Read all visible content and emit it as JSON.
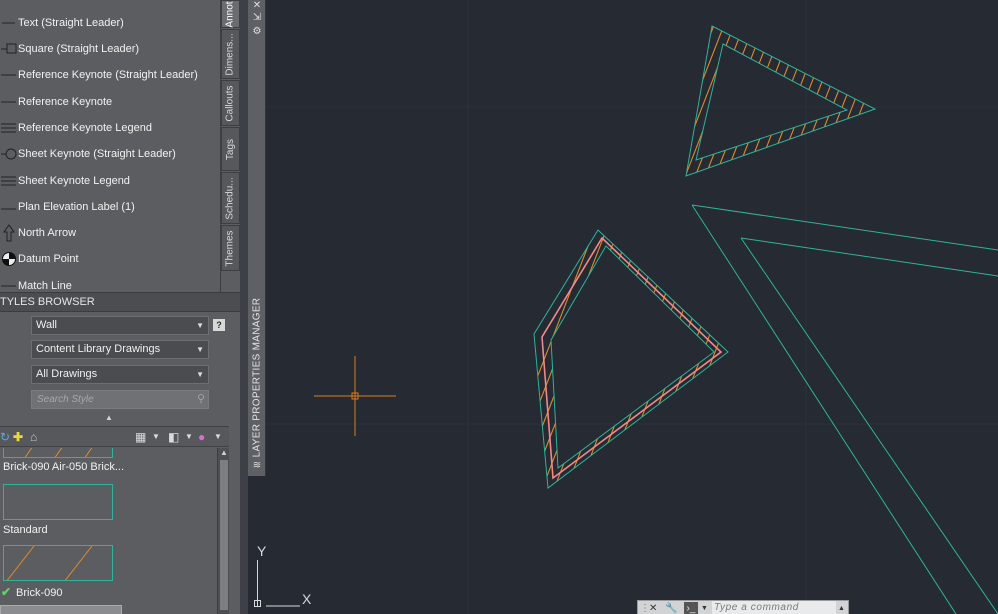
{
  "tool_palette": {
    "items": [
      {
        "label": "Text (Straight Leader)",
        "icon": "text-leader-icon"
      },
      {
        "label": "Square (Straight Leader)",
        "icon": "square-leader-icon"
      },
      {
        "label": "Reference Keynote (Straight Leader)",
        "icon": "keynote-leader-icon"
      },
      {
        "label": "Reference Keynote",
        "icon": "keynote-icon"
      },
      {
        "label": "Reference Keynote Legend",
        "icon": "keynote-legend-icon"
      },
      {
        "label": "Sheet Keynote (Straight Leader)",
        "icon": "sheet-keynote-leader-icon"
      },
      {
        "label": "Sheet Keynote Legend",
        "icon": "sheet-keynote-legend-icon"
      },
      {
        "label": "Plan Elevation Label (1)",
        "icon": "elevation-label-icon"
      },
      {
        "label": "North Arrow",
        "icon": "north-arrow-icon"
      },
      {
        "label": "Datum Point",
        "icon": "datum-point-icon"
      },
      {
        "label": "Match Line",
        "icon": "match-line-icon"
      }
    ],
    "tabs": [
      "Annot",
      "Dimens...",
      "Callouts",
      "Tags",
      "Schedu...",
      "Themes"
    ]
  },
  "layer_manager": {
    "label": "LAYER PROPERTIES MANAGER"
  },
  "styles_browser": {
    "title": "TYLES BROWSER",
    "object_type": "Wall",
    "source": "Content Library Drawings",
    "filter": "All Drawings",
    "search_placeholder": "Search Style",
    "styles": [
      {
        "name": "Brick-090 Air-050 Brick...",
        "current": false
      },
      {
        "name": "Standard",
        "current": false
      },
      {
        "name": "Brick-090",
        "current": true
      }
    ]
  },
  "command_line": {
    "placeholder": "Type a command"
  },
  "ucs": {
    "x": "X",
    "y": "Y"
  },
  "colors": {
    "canvas": "#252a33",
    "wall_outline": "#2fb39a",
    "hatch": "#e08a2c",
    "selected": "#f08a8a",
    "crosshair": "#e07a1c"
  }
}
